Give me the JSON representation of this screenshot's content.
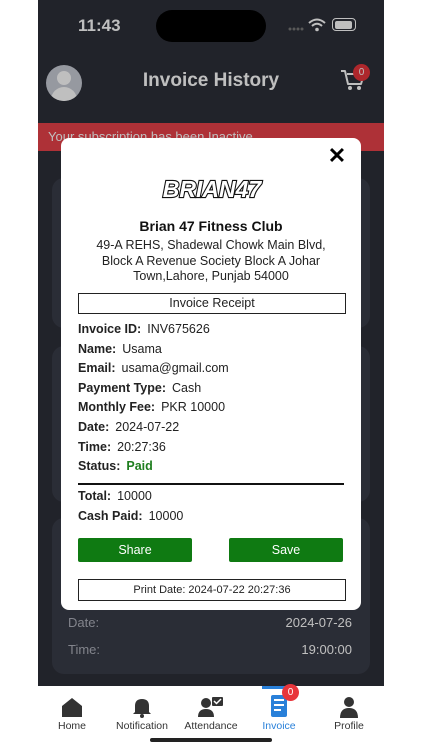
{
  "status_bar": {
    "time": "11:43"
  },
  "header": {
    "title": "Invoice History",
    "cart_count": "0"
  },
  "alert": {
    "text": "Your subscription has been Inactive"
  },
  "background_card": {
    "date_label": "Date:",
    "date_value": "2024-07-26",
    "time_label": "Time:",
    "time_value": "19:00:00"
  },
  "modal": {
    "logo_text": "BRIAN47",
    "club_name": "Brian 47 Fitness Club",
    "address_line1": "49-A REHS, Shadewal Chowk Main Blvd,",
    "address_line2": "Block A Revenue Society Block A Johar",
    "address_line3": "Town,Lahore, Punjab 54000",
    "receipt_title": "Invoice Receipt",
    "fields": [
      {
        "label": "Invoice ID:",
        "value": "INV675626"
      },
      {
        "label": "Name:",
        "value": "Usama"
      },
      {
        "label": "Email:",
        "value": "usama@gmail.com"
      },
      {
        "label": "Payment Type:",
        "value": "Cash"
      },
      {
        "label": "Monthly Fee:",
        "value": "PKR 10000"
      },
      {
        "label": "Date:",
        "value": "2024-07-22"
      },
      {
        "label": "Time:",
        "value": "20:27:36"
      },
      {
        "label": "Status:",
        "value": "Paid"
      }
    ],
    "totals": [
      {
        "label": "Total:",
        "value": "10000"
      },
      {
        "label": "Cash Paid:",
        "value": "10000"
      }
    ],
    "share_label": "Share",
    "save_label": "Save",
    "print_date": "Print Date: 2024-07-22 20:27:36",
    "status_color": "#1e7e1e",
    "button_color": "#0f7a12"
  },
  "tabs": [
    {
      "label": "Home",
      "icon": "home-icon"
    },
    {
      "label": "Notification",
      "icon": "bell-icon"
    },
    {
      "label": "Attendance",
      "icon": "attendance-icon"
    },
    {
      "label": "Invoice",
      "icon": "invoice-icon",
      "active": true,
      "badge": "0"
    },
    {
      "label": "Profile",
      "icon": "profile-icon"
    }
  ],
  "colors": {
    "accent": "#2980d9",
    "alert": "#e9424a",
    "badge": "#e8353b",
    "background": "#2d2f39"
  }
}
